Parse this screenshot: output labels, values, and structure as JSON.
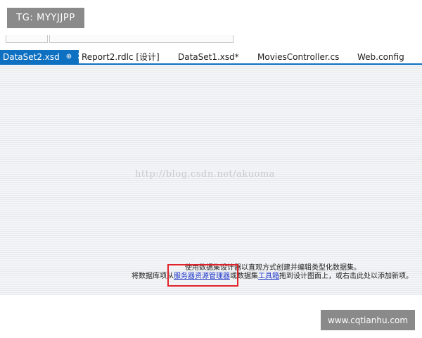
{
  "watermark_top": {
    "text": "TG: MYYJJPP"
  },
  "watermark_bottom": {
    "text": "www.cqtianhu.com"
  },
  "tabs": [
    {
      "label": "DataSet2.xsd",
      "active": true,
      "pin_glyph": "⊕",
      "close_glyph": "✕"
    },
    {
      "label": "Report2.rdlc [设计]",
      "active": false
    },
    {
      "label": "DataSet1.xsd*",
      "active": false
    },
    {
      "label": "MoviesController.cs",
      "active": false
    },
    {
      "label": "Web.config",
      "active": false
    }
  ],
  "designer": {
    "url_watermark": "http://blog.csdn.net/akuoma",
    "hint_line_1": "使用数据集设计器以直观方式创建并编辑类型化数据集。",
    "hint_line_2": {
      "before": "将数据库项从",
      "link_server_explorer": "服务器资源管理器",
      "middle": "或数据集",
      "link_toolbox": "工具箱",
      "after": "拖到设计图面上，或右击此处以添加新项。"
    }
  },
  "colors": {
    "active_tab": "#0e70c0",
    "highlight": "#e0232a",
    "link": "#1a33c8"
  }
}
